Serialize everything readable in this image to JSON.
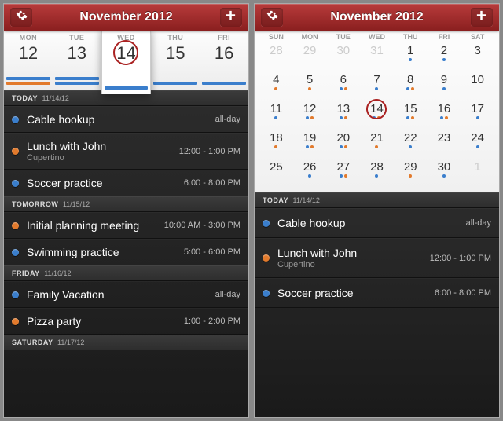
{
  "header": {
    "title": "November 2012"
  },
  "left": {
    "week": [
      {
        "dow": "MON",
        "num": "12",
        "bars": [
          "blue",
          "orange"
        ]
      },
      {
        "dow": "TUE",
        "num": "13",
        "bars": [
          "blue",
          "blue"
        ]
      },
      {
        "dow": "WED",
        "num": "14",
        "bars": [
          "blue"
        ],
        "selected": true
      },
      {
        "dow": "THU",
        "num": "15",
        "bars": [
          "blue"
        ]
      },
      {
        "dow": "FRI",
        "num": "16",
        "bars": [
          "blue"
        ]
      }
    ],
    "sections": [
      {
        "label": "TODAY",
        "date": "11/14/12",
        "events": [
          {
            "color": "blue",
            "title": "Cable hookup",
            "time": "all-day"
          },
          {
            "color": "orange",
            "title": "Lunch with John",
            "sub": "Cupertino",
            "time": "12:00 - 1:00 PM"
          },
          {
            "color": "blue",
            "title": "Soccer practice",
            "time": "6:00 - 8:00 PM"
          }
        ]
      },
      {
        "label": "TOMORROW",
        "date": "11/15/12",
        "events": [
          {
            "color": "orange",
            "title": "Initial planning meeting",
            "time": "10:00 AM - 3:00 PM"
          },
          {
            "color": "blue",
            "title": "Swimming practice",
            "time": "5:00 - 6:00 PM"
          }
        ]
      },
      {
        "label": "FRIDAY",
        "date": "11/16/12",
        "events": [
          {
            "color": "blue",
            "title": "Family Vacation",
            "time": "all-day"
          },
          {
            "color": "orange",
            "title": "Pizza party",
            "time": "1:00 - 2:00 PM"
          }
        ]
      },
      {
        "label": "SATURDAY",
        "date": "11/17/12",
        "events": []
      }
    ]
  },
  "right": {
    "dows": [
      "SUN",
      "MON",
      "TUE",
      "WED",
      "THU",
      "FRI",
      "SAT"
    ],
    "month": [
      {
        "n": "28",
        "dim": true
      },
      {
        "n": "29",
        "dim": true
      },
      {
        "n": "30",
        "dim": true
      },
      {
        "n": "31",
        "dim": true
      },
      {
        "n": "1",
        "dots": [
          "blue"
        ]
      },
      {
        "n": "2",
        "dots": [
          "blue"
        ]
      },
      {
        "n": "3"
      },
      {
        "n": "4",
        "dots": [
          "orange"
        ]
      },
      {
        "n": "5",
        "dots": [
          "orange"
        ]
      },
      {
        "n": "6",
        "dots": [
          "blue",
          "orange"
        ]
      },
      {
        "n": "7",
        "dots": [
          "blue"
        ]
      },
      {
        "n": "8",
        "dots": [
          "blue",
          "orange"
        ]
      },
      {
        "n": "9",
        "dots": [
          "blue"
        ]
      },
      {
        "n": "10"
      },
      {
        "n": "11",
        "dots": [
          "blue"
        ]
      },
      {
        "n": "12",
        "dots": [
          "blue",
          "orange"
        ]
      },
      {
        "n": "13",
        "dots": [
          "blue",
          "orange"
        ]
      },
      {
        "n": "14",
        "dots": [
          "blue",
          "orange"
        ],
        "selected": true
      },
      {
        "n": "15",
        "dots": [
          "blue",
          "orange"
        ]
      },
      {
        "n": "16",
        "dots": [
          "blue",
          "orange"
        ]
      },
      {
        "n": "17",
        "dots": [
          "blue"
        ]
      },
      {
        "n": "18",
        "dots": [
          "orange"
        ]
      },
      {
        "n": "19",
        "dots": [
          "blue",
          "orange"
        ]
      },
      {
        "n": "20",
        "dots": [
          "blue",
          "orange"
        ]
      },
      {
        "n": "21",
        "dots": [
          "orange"
        ]
      },
      {
        "n": "22",
        "dots": [
          "blue"
        ]
      },
      {
        "n": "23"
      },
      {
        "n": "24",
        "dots": [
          "blue"
        ]
      },
      {
        "n": "25"
      },
      {
        "n": "26",
        "dots": [
          "blue"
        ]
      },
      {
        "n": "27",
        "dots": [
          "blue",
          "orange"
        ]
      },
      {
        "n": "28",
        "dots": [
          "blue"
        ]
      },
      {
        "n": "29",
        "dots": [
          "orange"
        ]
      },
      {
        "n": "30",
        "dots": [
          "blue"
        ]
      },
      {
        "n": "1",
        "dim": true
      }
    ],
    "sections": [
      {
        "label": "TODAY",
        "date": "11/14/12",
        "events": [
          {
            "color": "blue",
            "title": "Cable hookup",
            "time": "all-day"
          },
          {
            "color": "orange",
            "title": "Lunch with John",
            "sub": "Cupertino",
            "time": "12:00 - 1:00 PM"
          },
          {
            "color": "blue",
            "title": "Soccer practice",
            "time": "6:00 - 8:00 PM"
          }
        ]
      }
    ]
  }
}
